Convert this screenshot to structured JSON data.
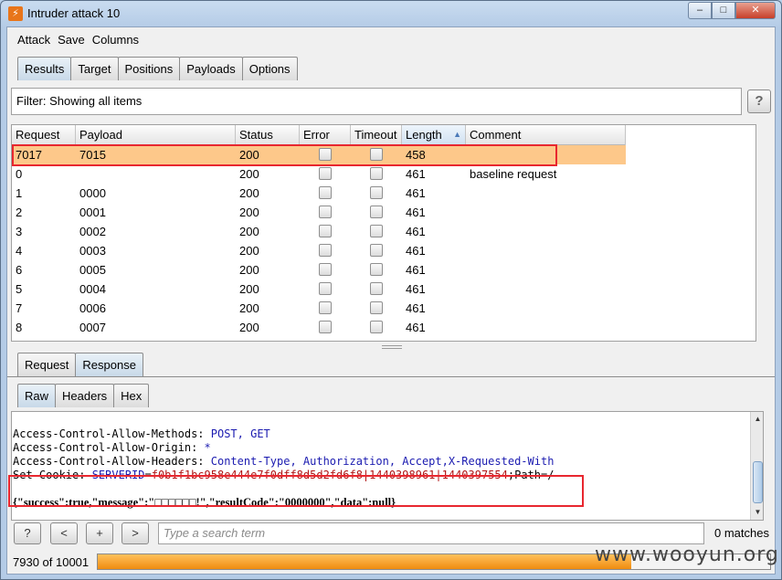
{
  "window": {
    "title": "Intruder attack 10",
    "minimize": "–",
    "maximize": "□",
    "close": "✕"
  },
  "menu": [
    "Attack",
    "Save",
    "Columns"
  ],
  "main_tabs": [
    "Results",
    "Target",
    "Positions",
    "Payloads",
    "Options"
  ],
  "filter": {
    "text": "Filter: Showing all items",
    "help": "?"
  },
  "table": {
    "columns": [
      "Request",
      "Payload",
      "Status",
      "Error",
      "Timeout",
      "Length",
      "Comment"
    ],
    "sorted_column": "Length",
    "rows": [
      {
        "request": "7017",
        "payload": "7015",
        "status": "200",
        "error": false,
        "timeout": false,
        "length": "458",
        "comment": "",
        "selected": true
      },
      {
        "request": "0",
        "payload": "",
        "status": "200",
        "error": false,
        "timeout": false,
        "length": "461",
        "comment": "baseline request"
      },
      {
        "request": "1",
        "payload": "0000",
        "status": "200",
        "error": false,
        "timeout": false,
        "length": "461",
        "comment": ""
      },
      {
        "request": "2",
        "payload": "0001",
        "status": "200",
        "error": false,
        "timeout": false,
        "length": "461",
        "comment": ""
      },
      {
        "request": "3",
        "payload": "0002",
        "status": "200",
        "error": false,
        "timeout": false,
        "length": "461",
        "comment": ""
      },
      {
        "request": "4",
        "payload": "0003",
        "status": "200",
        "error": false,
        "timeout": false,
        "length": "461",
        "comment": ""
      },
      {
        "request": "6",
        "payload": "0005",
        "status": "200",
        "error": false,
        "timeout": false,
        "length": "461",
        "comment": ""
      },
      {
        "request": "5",
        "payload": "0004",
        "status": "200",
        "error": false,
        "timeout": false,
        "length": "461",
        "comment": ""
      },
      {
        "request": "7",
        "payload": "0006",
        "status": "200",
        "error": false,
        "timeout": false,
        "length": "461",
        "comment": ""
      },
      {
        "request": "8",
        "payload": "0007",
        "status": "200",
        "error": false,
        "timeout": false,
        "length": "461",
        "comment": ""
      }
    ]
  },
  "detail_tabs": [
    "Request",
    "Response"
  ],
  "view_tabs": [
    "Raw",
    "Headers",
    "Hex"
  ],
  "response": {
    "headers": [
      {
        "key": "Access-Control-Allow-Methods: ",
        "value": "POST, GET"
      },
      {
        "key": "Access-Control-Allow-Origin: ",
        "value": "*"
      },
      {
        "key": "Access-Control-Allow-Headers: ",
        "value": "Content-Type, Authorization, Accept,X-Requested-With"
      }
    ],
    "cookie_key": "Set-Cookie: ",
    "cookie_name": "SERVERID",
    "cookie_eq": "=",
    "cookie_value": "f0b1f1bc958e444e7f0dff8d5d2fd6f8|1440398961|1440397554",
    "cookie_tail": ";Path=/",
    "body": "{\"success\":true,\"message\":\"□□□□□□!\",\"resultCode\":\"0000000\",\"data\":null}"
  },
  "search": {
    "help": "?",
    "prev": "<",
    "add": "+",
    "next": ">",
    "placeholder": "Type a search term",
    "matches": "0 matches"
  },
  "progress": {
    "label": "7930 of 10001",
    "fraction": 0.793
  },
  "watermark": "www.wooyun.org",
  "colors": {
    "selected_row": "#fdc88a",
    "highlight_box": "#e8272f",
    "progress": "#f08c10"
  }
}
